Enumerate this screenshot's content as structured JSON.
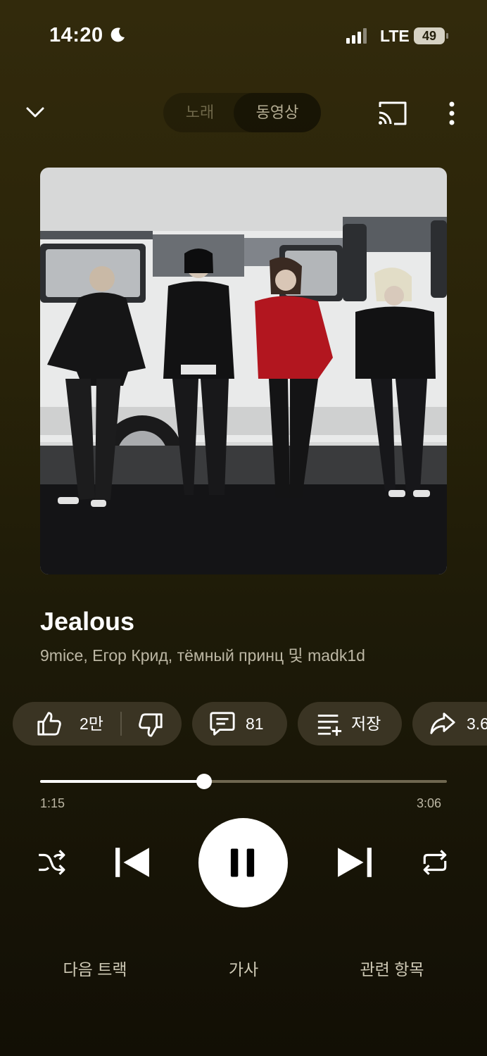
{
  "status_bar": {
    "time": "14:20",
    "network": "LTE",
    "battery": "49"
  },
  "top_bar": {
    "tab_song": "노래",
    "tab_video": "동영상"
  },
  "track": {
    "title": "Jealous",
    "artists": "9mice, Егор Крид, тёмный принц 및 madk1d"
  },
  "actions": {
    "like_count": "2만",
    "comment_count": "81",
    "save_label": "저장",
    "share_label": "3.6"
  },
  "progress": {
    "current": "1:15",
    "total": "3:06",
    "fraction": 0.403
  },
  "bottom_tabs": {
    "up_next": "다음 트랙",
    "lyrics": "가사",
    "related": "관련 항목"
  },
  "colors": {
    "accent": "#ffffff",
    "chip_bg": "#3a3423"
  },
  "icons": [
    "moon-icon",
    "signal-icon",
    "battery-icon",
    "chevron-down-icon",
    "cast-icon",
    "more-icon",
    "thumbs-up-icon",
    "thumbs-down-icon",
    "comment-icon",
    "playlist-add-icon",
    "share-icon",
    "shuffle-icon",
    "previous-icon",
    "pause-icon",
    "next-icon",
    "repeat-icon"
  ]
}
